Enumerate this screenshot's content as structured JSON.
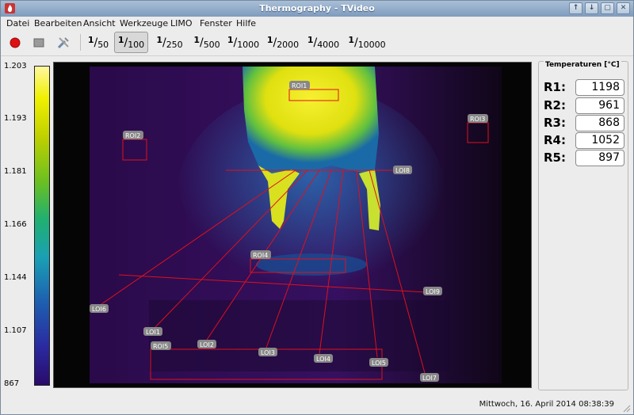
{
  "window": {
    "title": "Thermography - TVideo",
    "buttons": [
      "↑",
      "↓",
      "▢",
      "✕"
    ]
  },
  "menu": [
    {
      "label": "Datei"
    },
    {
      "label": "Bearbeiten"
    },
    {
      "label": "Ansicht"
    },
    {
      "label": "Werkzeuge"
    },
    {
      "label": "LIMO"
    },
    {
      "label": "Fenster"
    },
    {
      "label": "Hilfe"
    }
  ],
  "toolbar": {
    "record_icon": "record-icon",
    "stop_icon": "stop-icon",
    "tools_icon": "tools-icon",
    "shutter_numerator": "1",
    "shutter_options": [
      "50",
      "100",
      "250",
      "500",
      "1000",
      "2000",
      "4000",
      "10000"
    ],
    "shutter_selected": "100"
  },
  "scale": {
    "labels": [
      "1.203",
      "1.193",
      "1.181",
      "1.166",
      "1.144",
      "1.107",
      "867"
    ]
  },
  "overlays": {
    "rois": [
      {
        "label": "ROI1"
      },
      {
        "label": "ROI2"
      },
      {
        "label": "ROI3"
      },
      {
        "label": "ROI4"
      },
      {
        "label": "ROI5"
      }
    ],
    "lois": [
      {
        "label": "LOI1"
      },
      {
        "label": "LOI2"
      },
      {
        "label": "LOI3"
      },
      {
        "label": "LOI4"
      },
      {
        "label": "LOI5"
      },
      {
        "label": "LOI6"
      },
      {
        "label": "LOI7"
      },
      {
        "label": "LOI8"
      },
      {
        "label": "LOI9"
      }
    ]
  },
  "temperatures": {
    "title": "Temperaturen [°C]",
    "rows": [
      {
        "label": "R1:",
        "value": "1198"
      },
      {
        "label": "R2:",
        "value": "961"
      },
      {
        "label": "R3:",
        "value": "868"
      },
      {
        "label": "R4:",
        "value": "1052"
      },
      {
        "label": "R5:",
        "value": "897"
      }
    ]
  },
  "status": {
    "datetime": "Mittwoch, 16. April 2014 08:38:39"
  },
  "colors": {
    "overlay_red": "#e0101c",
    "titlebar": "#8fa9c8"
  }
}
